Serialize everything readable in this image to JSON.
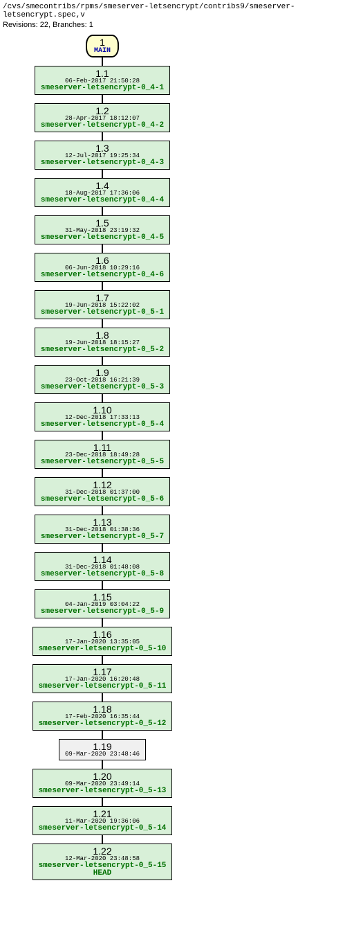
{
  "header": {
    "path": "/cvs/smecontribs/rpms/smeserver-letsencrypt/contribs9/smeserver-letsencrypt.spec,v",
    "revisions": "Revisions: 22, Branches: 1"
  },
  "trunk": {
    "number": "1",
    "label": "MAIN"
  },
  "nodes": [
    {
      "ver": "1.1",
      "date": "06-Feb-2017 21:50:28",
      "tag": "smeserver-letsencrypt-0_4-1",
      "plain": false,
      "extra": null
    },
    {
      "ver": "1.2",
      "date": "28-Apr-2017 18:12:07",
      "tag": "smeserver-letsencrypt-0_4-2",
      "plain": false,
      "extra": null
    },
    {
      "ver": "1.3",
      "date": "12-Jul-2017 19:25:34",
      "tag": "smeserver-letsencrypt-0_4-3",
      "plain": false,
      "extra": null
    },
    {
      "ver": "1.4",
      "date": "18-Aug-2017 17:36:06",
      "tag": "smeserver-letsencrypt-0_4-4",
      "plain": false,
      "extra": null
    },
    {
      "ver": "1.5",
      "date": "31-May-2018 23:19:32",
      "tag": "smeserver-letsencrypt-0_4-5",
      "plain": false,
      "extra": null
    },
    {
      "ver": "1.6",
      "date": "06-Jun-2018 10:29:16",
      "tag": "smeserver-letsencrypt-0_4-6",
      "plain": false,
      "extra": null
    },
    {
      "ver": "1.7",
      "date": "19-Jun-2018 15:22:02",
      "tag": "smeserver-letsencrypt-0_5-1",
      "plain": false,
      "extra": null
    },
    {
      "ver": "1.8",
      "date": "19-Jun-2018 18:15:27",
      "tag": "smeserver-letsencrypt-0_5-2",
      "plain": false,
      "extra": null
    },
    {
      "ver": "1.9",
      "date": "23-Oct-2018 16:21:39",
      "tag": "smeserver-letsencrypt-0_5-3",
      "plain": false,
      "extra": null
    },
    {
      "ver": "1.10",
      "date": "12-Dec-2018 17:33:13",
      "tag": "smeserver-letsencrypt-0_5-4",
      "plain": false,
      "extra": null
    },
    {
      "ver": "1.11",
      "date": "23-Dec-2018 18:49:28",
      "tag": "smeserver-letsencrypt-0_5-5",
      "plain": false,
      "extra": null
    },
    {
      "ver": "1.12",
      "date": "31-Dec-2018 01:37:00",
      "tag": "smeserver-letsencrypt-0_5-6",
      "plain": false,
      "extra": null
    },
    {
      "ver": "1.13",
      "date": "31-Dec-2018 01:38:36",
      "tag": "smeserver-letsencrypt-0_5-7",
      "plain": false,
      "extra": null
    },
    {
      "ver": "1.14",
      "date": "31-Dec-2018 01:48:08",
      "tag": "smeserver-letsencrypt-0_5-8",
      "plain": false,
      "extra": null
    },
    {
      "ver": "1.15",
      "date": "04-Jan-2019 03:04:22",
      "tag": "smeserver-letsencrypt-0_5-9",
      "plain": false,
      "extra": null
    },
    {
      "ver": "1.16",
      "date": "17-Jan-2020 13:35:05",
      "tag": "smeserver-letsencrypt-0_5-10",
      "plain": false,
      "extra": null
    },
    {
      "ver": "1.17",
      "date": "17-Jan-2020 16:20:48",
      "tag": "smeserver-letsencrypt-0_5-11",
      "plain": false,
      "extra": null
    },
    {
      "ver": "1.18",
      "date": "17-Feb-2020 16:35:44",
      "tag": "smeserver-letsencrypt-0_5-12",
      "plain": false,
      "extra": null
    },
    {
      "ver": "1.19",
      "date": "09-Mar-2020 23:48:46",
      "tag": null,
      "plain": true,
      "extra": null
    },
    {
      "ver": "1.20",
      "date": "09-Mar-2020 23:49:14",
      "tag": "smeserver-letsencrypt-0_5-13",
      "plain": false,
      "extra": null
    },
    {
      "ver": "1.21",
      "date": "11-Mar-2020 19:36:06",
      "tag": "smeserver-letsencrypt-0_5-14",
      "plain": false,
      "extra": null
    },
    {
      "ver": "1.22",
      "date": "12-Mar-2020 23:48:58",
      "tag": "smeserver-letsencrypt-0_5-15",
      "plain": false,
      "extra": "HEAD"
    }
  ]
}
